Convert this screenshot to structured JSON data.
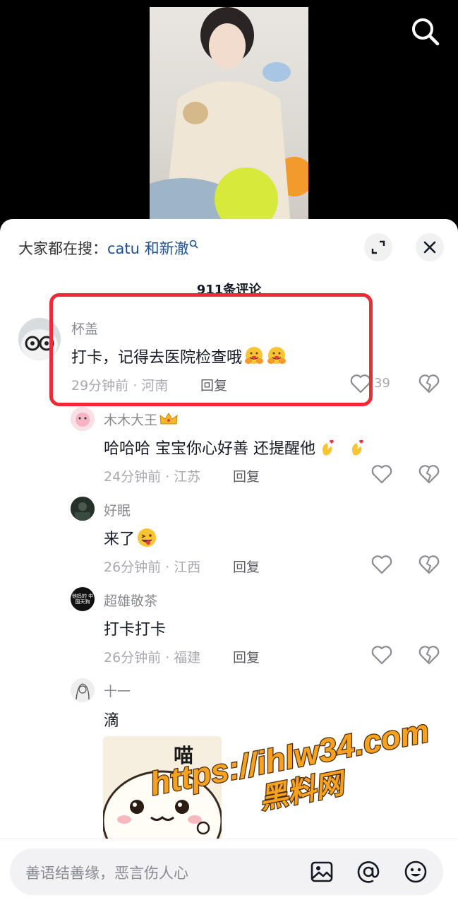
{
  "hot_search": {
    "prefix": "大家都在搜：",
    "keyword": "catu 和新澈"
  },
  "comment_count": "911条评论",
  "comments": [
    {
      "user": "杯盖",
      "text": "打卡，记得去医院检查哦",
      "time": "29分钟前 · 河南",
      "reply": "回复",
      "likes": "39",
      "emoji_count": 2
    },
    {
      "user": "木木大王",
      "badge": "crown-emoji",
      "text": "哈哈哈 宝宝你心好善 还提醒他",
      "time": "24分钟前 · 江苏",
      "reply": "回复",
      "emoji_count": 2
    },
    {
      "user": "好眠",
      "text": "来了",
      "time": "26分钟前 · 江西",
      "reply": "回复",
      "emoji_count": 1
    },
    {
      "user": "超雄敬茶",
      "avatar_text": "他妈的 中国天狗",
      "text": "打卡打卡",
      "time": "26分钟前 · 福建",
      "reply": "回复"
    },
    {
      "user": "十一",
      "text": "滴",
      "sticker_text": "喵"
    }
  ],
  "watermark": {
    "line1": "https://ihlw34.com",
    "line2": "黑料网"
  },
  "input": {
    "placeholder": "善语结善缘，恶言伤人心"
  },
  "icons": [
    "search-icon",
    "expand-icon",
    "close-icon",
    "heart-icon",
    "broken-heart-icon",
    "image-icon",
    "at-icon",
    "emoji-icon"
  ],
  "colors": {
    "highlight": "#ec2b35",
    "keyword": "#1f4f8f"
  }
}
